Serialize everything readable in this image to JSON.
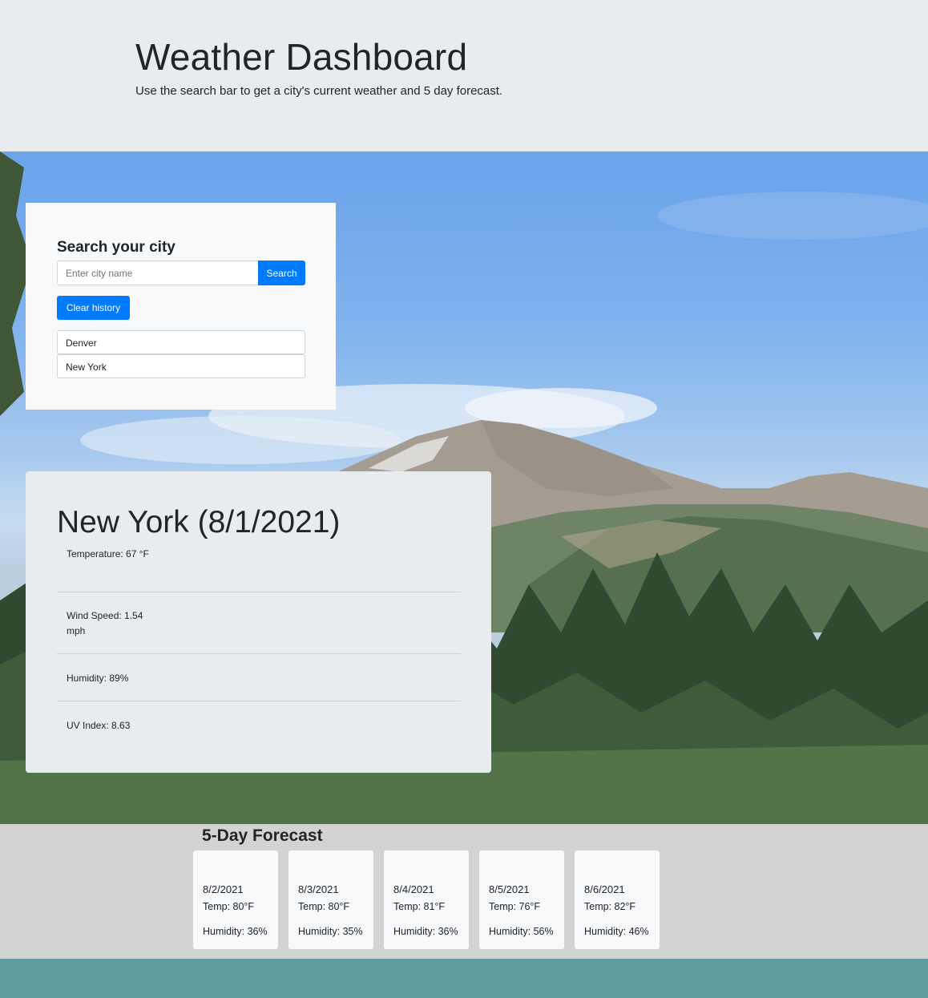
{
  "header": {
    "title": "Weather Dashboard",
    "subtitle": "Use the search bar to get a city's current weather and 5 day forecast."
  },
  "search": {
    "heading": "Search your city",
    "placeholder": "Enter city name",
    "button_label": "Search",
    "clear_label": "Clear history",
    "history": [
      "Denver",
      "New York"
    ]
  },
  "current": {
    "title": "New York (8/1/2021)",
    "temperature": "Temperature: 67 °F",
    "wind": "Wind Speed: 1.54 mph",
    "humidity": "Humidity: 89%",
    "uv": "UV Index: 8.63"
  },
  "forecast": {
    "heading": "5-Day Forecast",
    "days": [
      {
        "date": "8/2/2021",
        "temp": "Temp: 80°F",
        "humidity": "Humidity: 36%"
      },
      {
        "date": "8/3/2021",
        "temp": "Temp: 80°F",
        "humidity": "Humidity: 35%"
      },
      {
        "date": "8/4/2021",
        "temp": "Temp: 81°F",
        "humidity": "Humidity: 36%"
      },
      {
        "date": "8/5/2021",
        "temp": "Temp: 76°F",
        "humidity": "Humidity: 56%"
      },
      {
        "date": "8/6/2021",
        "temp": "Temp: 82°F",
        "humidity": "Humidity: 46%"
      }
    ]
  },
  "colors": {
    "primary": "#007bff",
    "jumbotron": "#e9ecef",
    "forecast_bg": "#d3d3d3",
    "footer": "#5f9ea0"
  }
}
